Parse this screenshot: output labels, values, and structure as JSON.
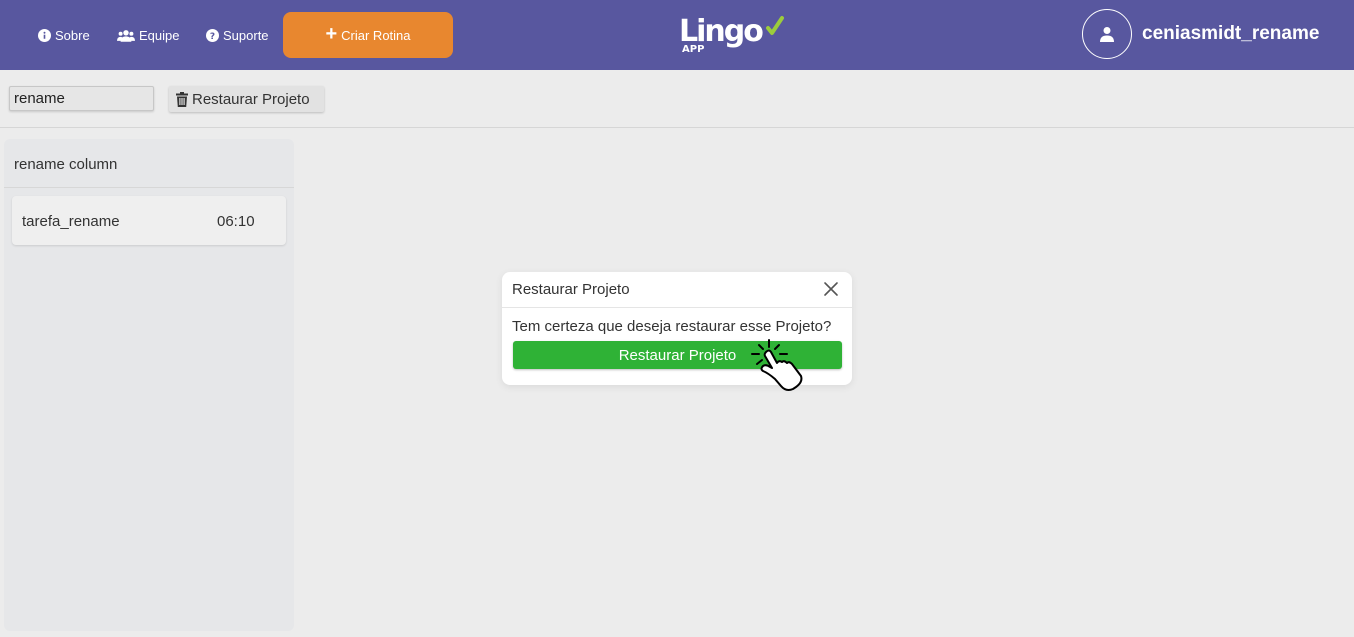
{
  "header": {
    "nav": [
      {
        "label": "Sobre",
        "icon": "info-icon"
      },
      {
        "label": "Equipe",
        "icon": "users-icon"
      },
      {
        "label": "Suporte",
        "icon": "question-icon"
      }
    ],
    "create_button": {
      "label": "Criar Rotina",
      "icon": "plus-icon"
    },
    "logo": {
      "name": "Lingo App logo",
      "icon": "lingo-logo"
    },
    "user": {
      "name": "ceniasmidt_rename",
      "icon": "user-avatar-icon"
    }
  },
  "toolbar": {
    "project_name_value": "rename",
    "restore_button_label": "Restaurar Projeto",
    "restore_button_icon": "trash-icon"
  },
  "board": {
    "columns": [
      {
        "title": "rename column",
        "tasks": [
          {
            "name": "tarefa_rename",
            "time": "06:10"
          }
        ]
      }
    ]
  },
  "modal": {
    "title": "Restaurar Projeto",
    "message": "Tem certeza que deseja restaurar esse Projeto?",
    "confirm_label": "Restaurar Projeto",
    "close_icon": "close-icon"
  },
  "colors": {
    "header_bg": "#58579f",
    "create_button_bg": "#e8872f",
    "confirm_button_bg": "#2fb236",
    "page_bg": "#ececec",
    "logo_check": "#9ccc3c"
  }
}
